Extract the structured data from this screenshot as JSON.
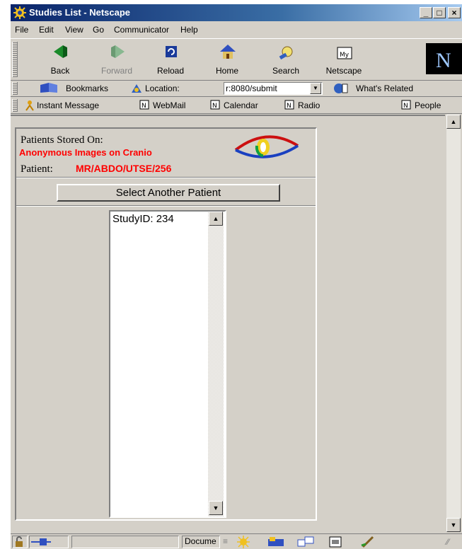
{
  "window": {
    "title": "Studies List - Netscape"
  },
  "menu": [
    "File",
    "Edit",
    "View",
    "Go",
    "Communicator",
    "Help"
  ],
  "nav_buttons": [
    {
      "label": "Back",
      "icon": "back-arrow-icon",
      "enabled": true
    },
    {
      "label": "Forward",
      "icon": "forward-arrow-icon",
      "enabled": false
    },
    {
      "label": "Reload",
      "icon": "reload-icon",
      "enabled": true
    },
    {
      "label": "Home",
      "icon": "home-icon",
      "enabled": true
    },
    {
      "label": "Search",
      "icon": "search-icon",
      "enabled": true
    },
    {
      "label": "Netscape",
      "icon": "my-netscape-icon",
      "enabled": true
    }
  ],
  "location_bar": {
    "bookmarks_label": "Bookmarks",
    "location_label": "Location:",
    "url_value": "r:8080/submit",
    "whats_related_label": "What's Related"
  },
  "personal_bar": [
    "Instant Message",
    "WebMail",
    "Calendar",
    "Radio",
    "People"
  ],
  "page": {
    "stored_on_label": "Patients Stored On:",
    "storage_name": "Anonymous Images on Cranio",
    "patient_label": "Patient:",
    "patient_id": "MR/ABDO/UTSE/256",
    "select_button_label": "Select Another Patient",
    "studies": [
      "StudyID: 234"
    ]
  },
  "status_bar": {
    "text": "Docume"
  },
  "colors": {
    "highlight_red": "#ff0000",
    "title_bar": "#0a246a",
    "chrome": "#d4d0c8"
  }
}
